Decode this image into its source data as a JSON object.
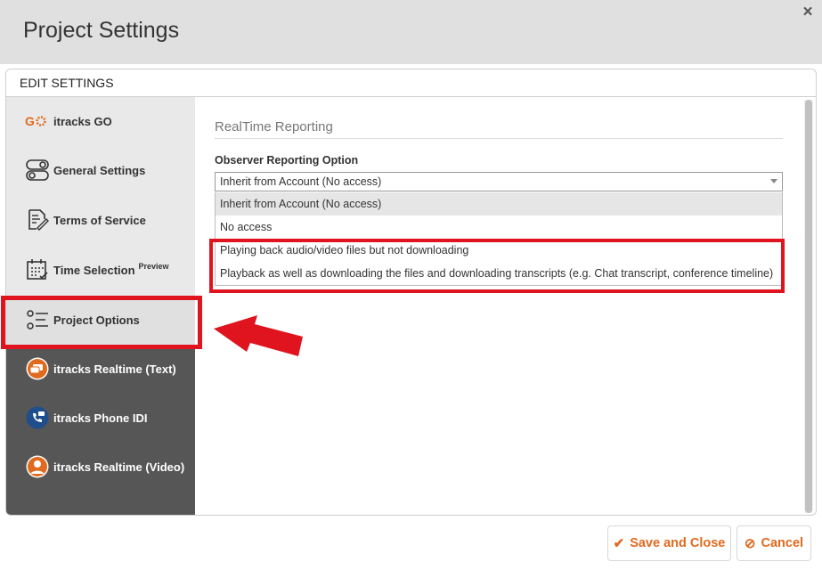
{
  "header": {
    "title": "Project Settings",
    "close_glyph": "×"
  },
  "panel": {
    "heading": "EDIT SETTINGS"
  },
  "sidebar": {
    "items": [
      {
        "id": "itracks-go",
        "label": "itracks GO",
        "icon": "go-logo-icon"
      },
      {
        "id": "general-settings",
        "label": "General Settings",
        "icon": "toggle-icon"
      },
      {
        "id": "terms-of-service",
        "label": "Terms of Service",
        "icon": "document-sign-icon"
      },
      {
        "id": "time-selection",
        "label": "Time Selection",
        "badge": "Preview",
        "icon": "calendar-icon"
      },
      {
        "id": "project-options",
        "label": "Project Options",
        "icon": "options-list-icon"
      },
      {
        "id": "realtime-text",
        "label": "itracks Realtime (Text)",
        "icon": "chat-bubbles-icon"
      },
      {
        "id": "phone-idi",
        "label": "itracks Phone IDI",
        "icon": "phone-icon"
      },
      {
        "id": "realtime-video",
        "label": "itracks Realtime (Video)",
        "icon": "user-icon"
      }
    ],
    "active": "project-options"
  },
  "content": {
    "section_title": "RealTime Reporting",
    "field_label": "Observer Reporting Option",
    "select_value": "Inherit from Account (No access)",
    "options": [
      "Inherit from Account (No access)",
      "No access",
      "Playing back audio/video files but not downloading",
      "Playback as well as downloading the files and downloading transcripts (e.g. Chat transcript, conference timeline)"
    ]
  },
  "footer": {
    "save_label": "Save and Close",
    "cancel_label": "Cancel"
  },
  "colors": {
    "accent": "#e06a1e",
    "highlight": "#e0141e",
    "sidebar_dark": "#565656"
  }
}
